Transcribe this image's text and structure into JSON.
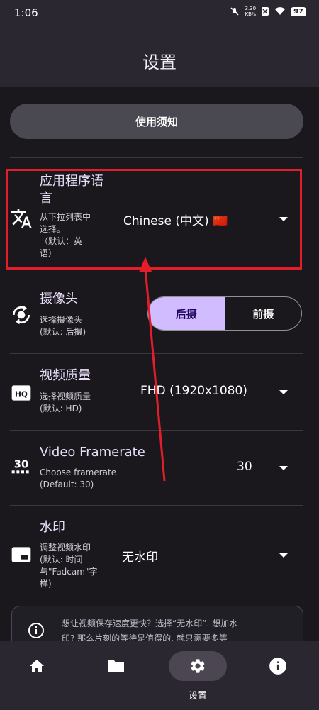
{
  "status": {
    "time": "1:06",
    "speed_top": "3.30",
    "speed_unit": "KB/s",
    "battery": "97"
  },
  "header": {
    "title": "设置"
  },
  "notice_button": {
    "label": "使用须知"
  },
  "language": {
    "title_line1": "应用程序语",
    "title_line2": "言",
    "desc_line1": "从下拉列表中",
    "desc_line2": "选择。",
    "desc_line3": "（默认：英",
    "desc_line4": "语）",
    "value": "Chinese (中文) 🇨🇳"
  },
  "camera": {
    "title": "摄像头",
    "desc_line1": "选择摄像头",
    "desc_line2": "(默认: 后摄)",
    "back_label": "后摄",
    "front_label": "前摄",
    "selected": "后摄"
  },
  "video_quality": {
    "title": "视频质量",
    "desc_line1": "选择视频质量",
    "desc_line2": "(默认: HD)",
    "value": "FHD (1920x1080)"
  },
  "framerate": {
    "title": "Video Framerate",
    "desc_line1": "Choose framerate",
    "desc_line2": "(Default: 30)",
    "value": "30"
  },
  "watermark": {
    "title": "水印",
    "desc_line1": "调整视频水印",
    "desc_line2": "(默认: 时间",
    "desc_line3": "与\"Fadcam\"字",
    "desc_line4": "样)",
    "value": "无水印"
  },
  "tip": {
    "line1": "想让视频保存速度更快？选择“无水印”. 想加水",
    "line2": "印? 那么片刻的等待是值得的, 就只需要多等一"
  },
  "bottom_nav": {
    "active_label": "设置"
  },
  "colors": {
    "accent": "#d0bcff",
    "annotation": "#e41d2b",
    "background": "#1a181d"
  }
}
